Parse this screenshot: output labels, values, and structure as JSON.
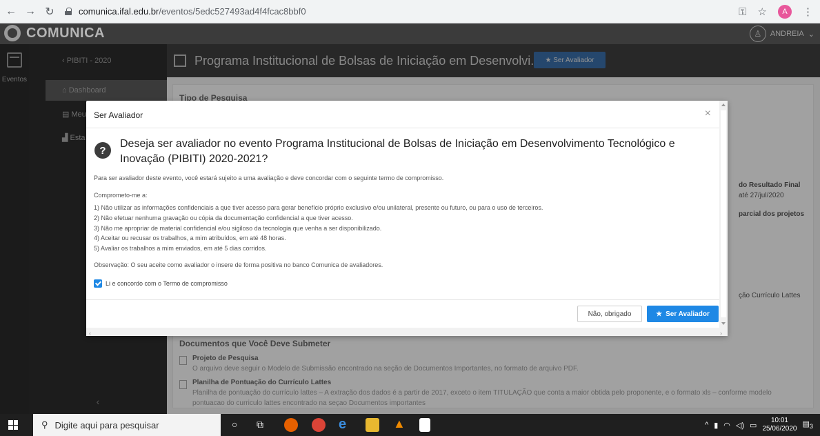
{
  "browser": {
    "url_host": "comunica.ifal.edu.br",
    "url_path": "/eventos/5edc527493ad4f4fcac8bbf0",
    "profile_initial": "A"
  },
  "app": {
    "logo_text": "COMUNICA",
    "user_name": "ANDREIA",
    "rail_label": "Eventos"
  },
  "sidebar": {
    "back_label": "PIBITI - 2020",
    "items": [
      {
        "label": "Dashboard"
      },
      {
        "label": "Meu"
      },
      {
        "label": "Esta"
      }
    ]
  },
  "main": {
    "title": "Programa Institucional de Bolsas de Iniciação em Desenvolvi...",
    "header_button": "Ser Avaliador",
    "section_tipo": "Tipo de Pesquisa",
    "side_texts": [
      "do Resultado Final",
      "até 27/jul/2020",
      "parcial dos projetos",
      "ção Currículo Lattes"
    ],
    "documentos_title": "Documentos que Você Deve Submeter",
    "docs": [
      {
        "title": "Projeto de Pesquisa",
        "desc": "O arquivo deve seguir o Modelo de Submissão encontrado na seção de Documentos Importantes, no formato de arquivo PDF."
      },
      {
        "title": "Planilha de Pontuação do Currículo Lattes",
        "desc": "Planilha de pontuação do currículo lattes – A extração dos dados é a partir de 2017, exceto o item TITULAÇÃO que conta a maior obtida pelo proponente, e o formato xls – conforme modelo",
        "desc2": "pontuacao do curriculo lattes encontrado na seçao Documentos importantes"
      }
    ]
  },
  "modal": {
    "title": "Ser Avaliador",
    "heading": "Deseja ser avaliador no evento Programa Institucional de Bolsas de Iniciação em Desenvolvimento Tecnológico e Inovação (PIBITI) 2020-2021?",
    "intro": "Para ser avaliador deste evento, você estará sujeito a uma avaliação e deve concordar com o seguinte termo de compromisso.",
    "commit_label": "Comprometo-me a:",
    "terms": [
      "1) Não utilizar as informações confidenciais a que tiver acesso para gerar benefício próprio exclusivo e/ou unilateral, presente ou futuro, ou para o uso de terceiros.",
      "2) Não efetuar nenhuma gravação ou cópia da documentação confidencial a que tiver acesso.",
      "3) Não me apropriar de material confidencial e/ou sigiloso da tecnologia que venha a ser disponibilizado.",
      "4) Aceitar ou recusar os trabalhos, a mim atribuídos, em até 48 horas.",
      "5) Avaliar os trabalhos a mim enviados, em até 5 dias corridos."
    ],
    "observation": "Observação: O seu aceite como avaliador o insere de forma positiva no banco Comunica de avaliadores.",
    "checkbox_label": "Li e concordo com o Termo de compromisso",
    "checkbox_checked": true,
    "btn_no": "Não, obrigado",
    "btn_yes": "Ser Avaliador"
  },
  "taskbar": {
    "search_placeholder": "Digite aqui para pesquisar",
    "time": "10:01",
    "date": "25/06/2020",
    "notifications": "3"
  }
}
